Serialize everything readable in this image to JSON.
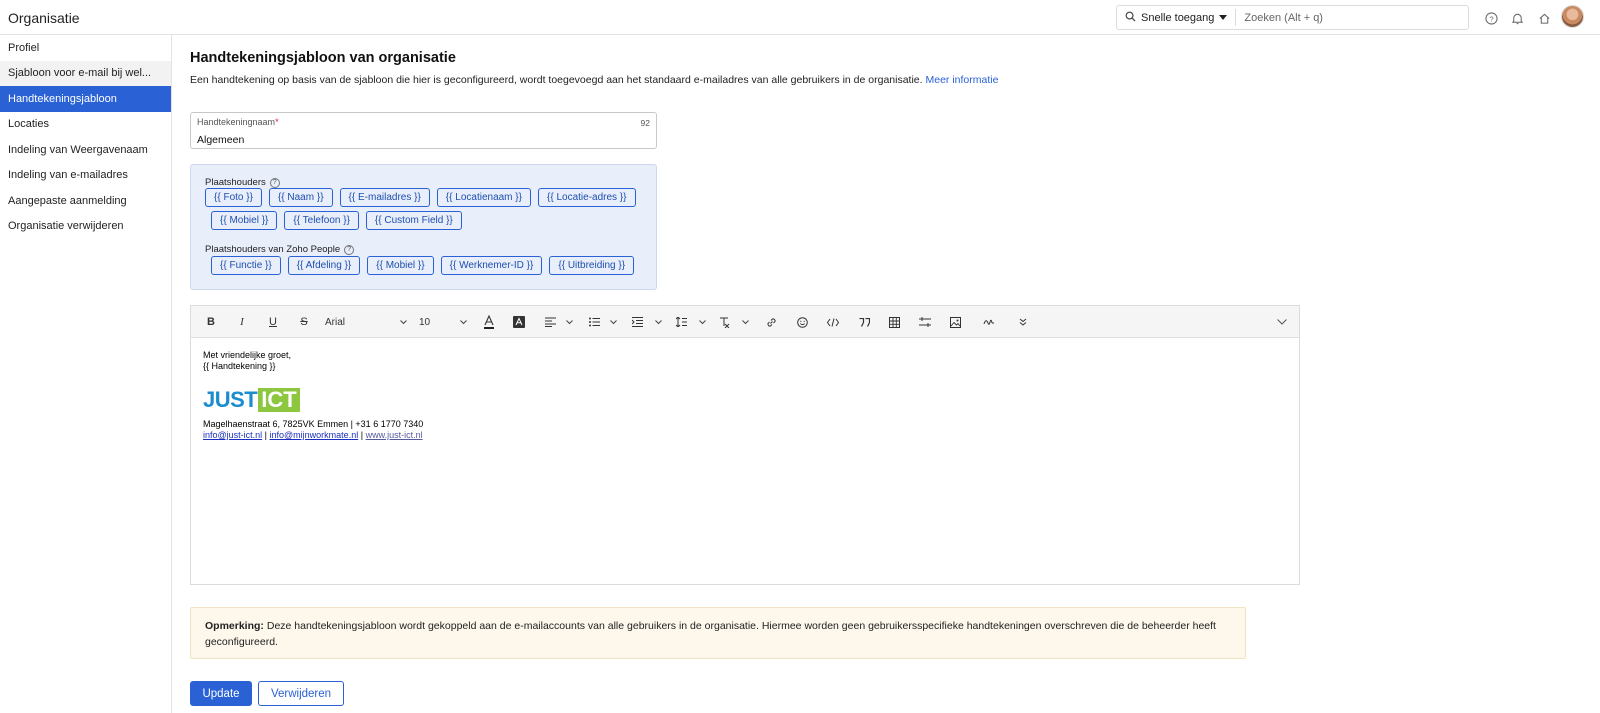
{
  "header": {
    "title": "Organisatie",
    "quick_access_label": "Snelle toegang",
    "search_placeholder": "Zoeken (Alt + q)"
  },
  "sidebar": {
    "items": [
      {
        "label": "Profiel",
        "state": "normal"
      },
      {
        "label": "Sjabloon voor e-mail bij wel...",
        "state": "hover"
      },
      {
        "label": "Handtekeningsjabloon",
        "state": "active"
      },
      {
        "label": "Locaties",
        "state": "normal"
      },
      {
        "label": "Indeling van Weergavenaam",
        "state": "normal"
      },
      {
        "label": "Indeling van e-mailadres",
        "state": "normal"
      },
      {
        "label": "Aangepaste aanmelding",
        "state": "normal"
      },
      {
        "label": "Organisatie verwijderen",
        "state": "normal"
      }
    ]
  },
  "main": {
    "title": "Handtekeningsjabloon van organisatie",
    "description": "Een handtekening op basis van de sjabloon die hier is geconfigureerd, wordt toegevoegd aan het standaard e-mailadres van alle gebruikers in de organisatie.",
    "more_info_link": "Meer informatie",
    "signature_name": {
      "label": "Handtekeningnaam",
      "required_mark": "*",
      "remaining_chars": "92",
      "value": "Algemeen"
    },
    "placeholders": {
      "title": "Plaatshouders",
      "row1": [
        "{{ Foto }}",
        "{{ Naam }}",
        "{{ E-mailadres }}",
        "{{ Locatienaam }}",
        "{{ Locatie-adres }}"
      ],
      "row2": [
        "{{ Mobiel }}",
        "{{ Telefoon }}",
        "{{ Custom Field }}"
      ],
      "people_title": "Plaatshouders van Zoho People",
      "people_row": [
        "{{ Functie }}",
        "{{ Afdeling }}",
        "{{ Mobiel }}",
        "{{ Werknemer-ID }}",
        "{{ Uitbreiding }}"
      ]
    },
    "editor": {
      "font_family": "Arial",
      "font_size": "10",
      "content": {
        "greeting": "Met vriendelijke groet,",
        "signature_placeholder": "{{ Handtekening }}",
        "logo_part1": "JUST",
        "logo_part2": "ICT",
        "address": "Magelhaenstraat 6, 7825VK Emmen | +31 6 1770 7340",
        "email1": "info@just-ict.nl",
        "email2": "info@mijnworkmate.nl",
        "website": "www.just-ict.nl",
        "separator": "|"
      }
    },
    "note": {
      "label": "Opmerking:",
      "text": "Deze handtekeningsjabloon wordt gekoppeld aan de e-mailaccounts van alle gebruikers in de organisatie. Hiermee worden geen gebruikersspecifieke handtekeningen overschreven die de beheerder heeft geconfigureerd."
    },
    "buttons": {
      "update": "Update",
      "delete": "Verwijderen"
    }
  },
  "colors": {
    "accent": "#2a62d6",
    "placeholder_panel_bg": "#e8eefa",
    "note_bg": "#fdf7ec",
    "logo_blue": "#1a8ccf",
    "logo_green": "#8dc63f"
  }
}
